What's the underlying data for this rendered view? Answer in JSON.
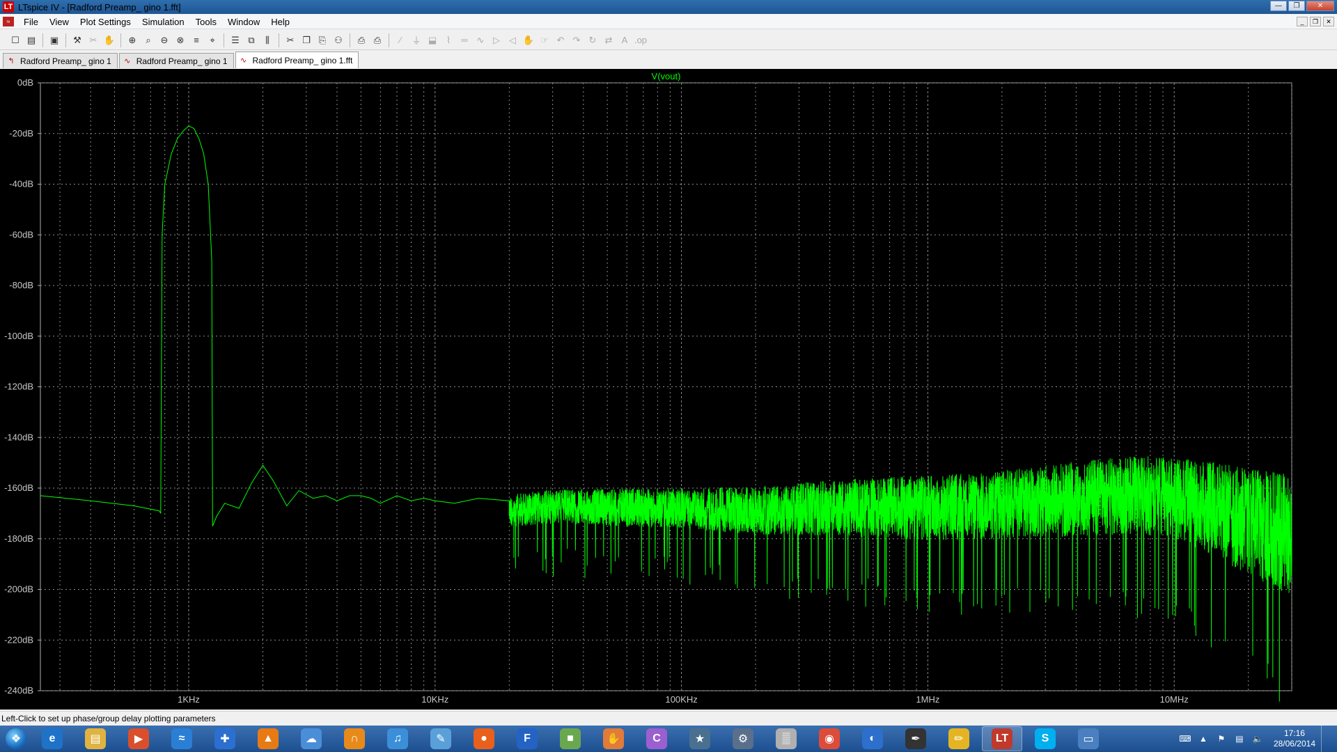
{
  "window": {
    "title": "LTspice IV - [Radford Preamp_ gino 1.fft]",
    "app_icon": "ltspice-logo-icon",
    "controls": [
      "minimize-icon",
      "restore-icon",
      "close-icon"
    ]
  },
  "menu": {
    "items": [
      "File",
      "View",
      "Plot Settings",
      "Simulation",
      "Tools",
      "Window",
      "Help"
    ]
  },
  "toolbar": {
    "icons": [
      "new-schematic-icon",
      "open-icon",
      "save-icon",
      "control-panel-icon",
      "cut-wire-icon",
      "pan-icon",
      "zoom-in-icon",
      "zoom-area-icon",
      "zoom-out-icon",
      "zoom-full-icon",
      "autorange-icon",
      "fit-icon",
      "tile-horizontal-icon",
      "cascade-icon",
      "tile-vertical-icon",
      "cut-icon",
      "copy-icon",
      "paste-icon",
      "find-icon",
      "print-setup-icon",
      "print-icon",
      "wire-icon",
      "ground-icon",
      "label-icon",
      "resistor-icon",
      "capacitor-icon",
      "inductor-icon",
      "diode-icon",
      "component-icon",
      "move-icon",
      "drag-icon",
      "undo-icon",
      "redo-icon",
      "rotate-icon",
      "mirror-icon",
      "text-icon",
      "spice-directive-icon"
    ]
  },
  "tabs": [
    {
      "label": "Radford Preamp_ gino 1",
      "icon": "schematic-icon",
      "active": false
    },
    {
      "label": "Radford Preamp_ gino 1",
      "icon": "waveform-icon",
      "active": false
    },
    {
      "label": "Radford Preamp_ gino 1.fft",
      "icon": "waveform-icon",
      "active": true
    }
  ],
  "chart_data": {
    "type": "line",
    "title": "V(vout)",
    "xscale": "log",
    "xlim": [
      250,
      30000000
    ],
    "ylim": [
      -240,
      0
    ],
    "grid": true,
    "xticks": [
      {
        "value": 1000,
        "label": "1KHz"
      },
      {
        "value": 10000,
        "label": "10KHz"
      },
      {
        "value": 100000,
        "label": "100KHz"
      },
      {
        "value": 1000000,
        "label": "1MHz"
      },
      {
        "value": 10000000,
        "label": "10MHz"
      }
    ],
    "yticks": [
      {
        "value": 0,
        "label": "0dB"
      },
      {
        "value": -20,
        "label": "-20dB"
      },
      {
        "value": -40,
        "label": "-40dB"
      },
      {
        "value": -60,
        "label": "-60dB"
      },
      {
        "value": -80,
        "label": "-80dB"
      },
      {
        "value": -100,
        "label": "-100dB"
      },
      {
        "value": -120,
        "label": "-120dB"
      },
      {
        "value": -140,
        "label": "-140dB"
      },
      {
        "value": -160,
        "label": "-160dB"
      },
      {
        "value": -180,
        "label": "-180dB"
      },
      {
        "value": -200,
        "label": "-200dB"
      },
      {
        "value": -220,
        "label": "-220dB"
      },
      {
        "value": -240,
        "label": "-240dB"
      }
    ],
    "series": [
      {
        "name": "V(vout)",
        "color": "#00ff00",
        "x": [
          250,
          400,
          600,
          760,
          770,
          780,
          800,
          850,
          900,
          950,
          1000,
          1050,
          1100,
          1150,
          1200,
          1240,
          1250,
          1300,
          1400,
          1600,
          1800,
          2000,
          2200,
          2500,
          2800,
          3200,
          3600,
          4000,
          4500,
          5000,
          5500,
          6000,
          7000,
          8000,
          9000,
          10000,
          12000,
          15000,
          20000,
          30000,
          50000,
          100000,
          200000,
          400000,
          700000,
          1000000,
          2000000,
          4000000,
          7000000,
          10000000,
          15000000,
          20000000,
          30000000
        ],
        "y": [
          -163,
          -165,
          -167,
          -169,
          -170,
          -60,
          -40,
          -28,
          -22,
          -19,
          -17,
          -18,
          -22,
          -28,
          -40,
          -70,
          -175,
          -171,
          -166,
          -168,
          -158,
          -151,
          -157,
          -167,
          -161,
          -164,
          -163,
          -165,
          -163,
          -163,
          -164,
          -166,
          -163,
          -165,
          -164,
          -165,
          -166,
          -164,
          -165,
          -163,
          -163,
          -163,
          -163,
          -161,
          -160,
          -160,
          -158,
          -155,
          -153,
          -154,
          -157,
          -160,
          -164
        ],
        "noise_band_db": [
          [
            20000,
            8
          ],
          [
            100000,
            10
          ],
          [
            1000000,
            16
          ],
          [
            10000000,
            20
          ],
          [
            30000000,
            30
          ]
        ]
      }
    ]
  },
  "statusbar": {
    "text": "Left-Click to set up phase/group delay plotting parameters"
  },
  "taskbar": {
    "start": "windows-start-icon",
    "apps": [
      "internet-explorer-icon",
      "file-explorer-icon",
      "media-player-icon",
      "network-icon",
      "plus-tool-icon",
      "vlc-icon",
      "chat-icon",
      "headphones-icon",
      "itunes-icon",
      "notepad-icon",
      "firefox-icon",
      "cad-icon",
      "layers-icon",
      "hand-icon",
      "spiral-icon",
      "cat-icon",
      "scanner-icon",
      "calculator-icon",
      "chrome-icon",
      "globe-icon",
      "pen-tool-icon",
      "pencil-icon",
      "ltspice-taskbar-icon",
      "skype-icon",
      "remote-desktop-icon"
    ],
    "active_app": "ltspice-taskbar-icon",
    "tray": [
      "keyboard-icon",
      "up-arrow-icon",
      "flag-icon",
      "signal-icon",
      "volume-icon"
    ],
    "clock_time": "17:16",
    "clock_date": "28/06/2014"
  }
}
